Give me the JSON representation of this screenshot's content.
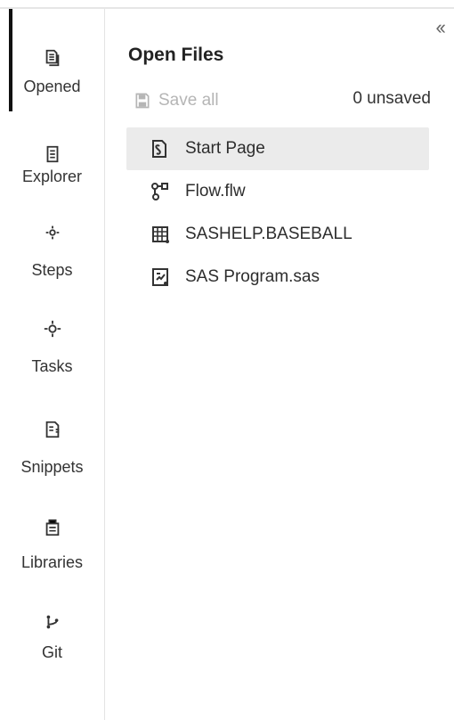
{
  "navigation": {
    "collapse_symbol": "‹‹",
    "items": [
      {
        "label": "Opened",
        "icon": "document-stack-icon"
      },
      {
        "label": "Explorer",
        "icon": "explorer-file-icon"
      },
      {
        "label": "Steps",
        "icon": "steps-icon"
      },
      {
        "label": "Tasks",
        "icon": "tasks-icon"
      },
      {
        "label": "Snippets",
        "icon": "snippets-icon"
      },
      {
        "label": "Libraries",
        "icon": "libraries-icon"
      },
      {
        "label": "Git",
        "icon": "git-branch-icon"
      }
    ]
  },
  "panel": {
    "title": "Open Files",
    "save_all": "Save all",
    "unsaved": "0 unsaved",
    "files": [
      {
        "name": "Start Page",
        "icon": "start-page-icon"
      },
      {
        "name": "Flow.flw",
        "icon": "flow-icon"
      },
      {
        "name": "SASHELP.BASEBALL",
        "icon": "table-icon"
      },
      {
        "name": "SAS Program.sas",
        "icon": "sas-program-icon"
      }
    ]
  },
  "colors": {
    "accent": "#111111",
    "selected": "#ebebeb",
    "muted": "#b5b5b5"
  }
}
